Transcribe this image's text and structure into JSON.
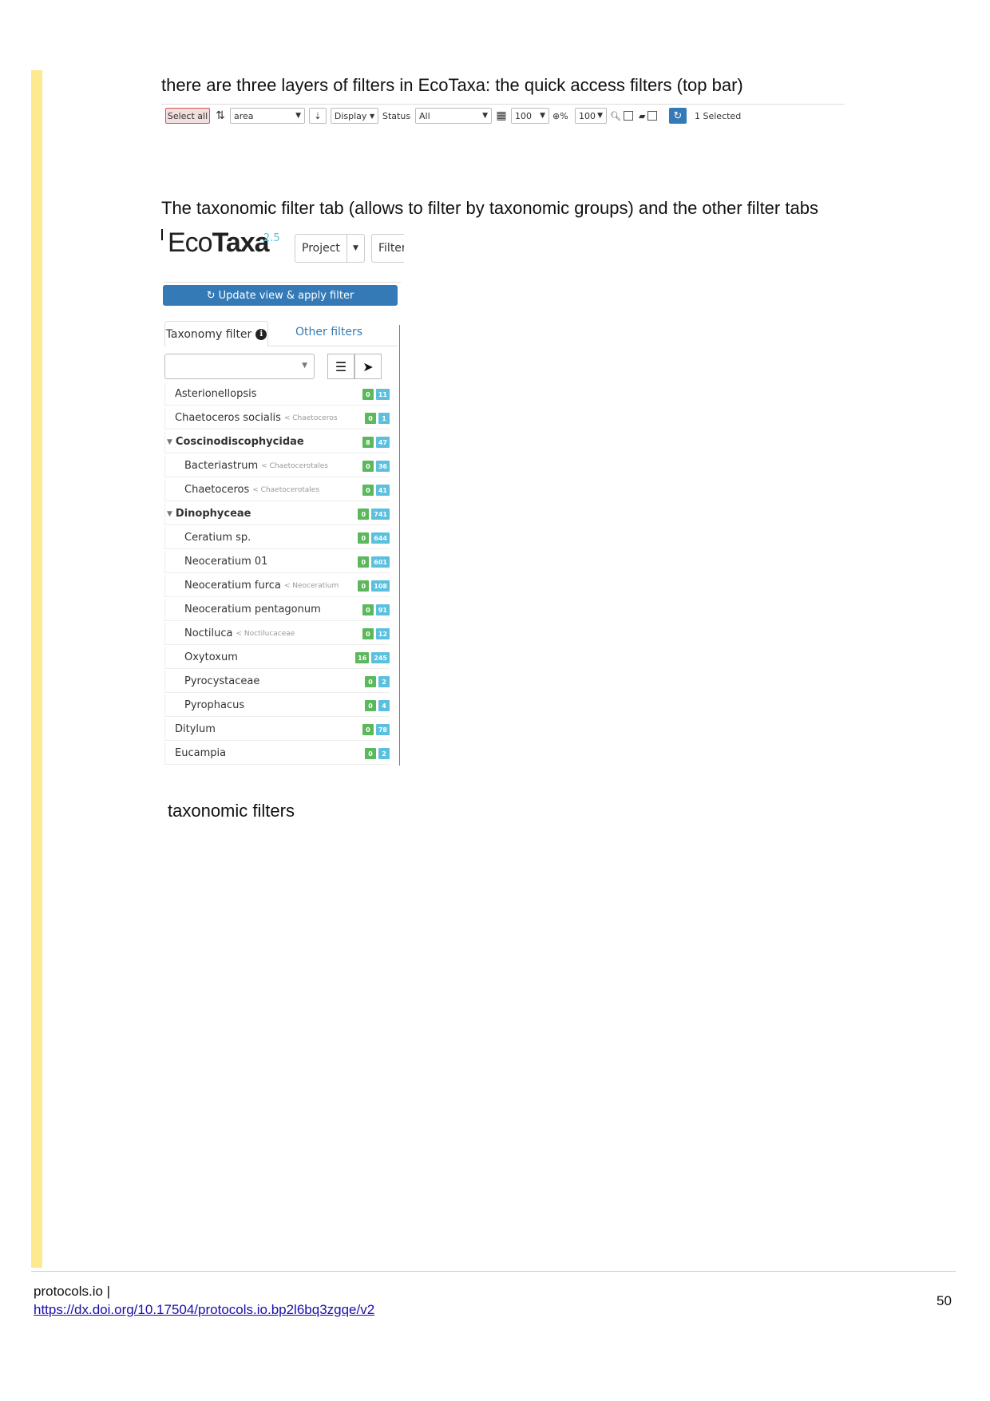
{
  "text": {
    "p1": "there are three layers of filters in EcoTaxa: the quick access filters (top bar)",
    "p2": "The taxonomic filter tab (allows to filter by taxonomic groups) and the other filter tabs",
    "caption": "taxonomic filters"
  },
  "toolbar": {
    "select_all": "Select all",
    "sort_field": "area",
    "display_label": "Display",
    "status_label": "Status",
    "status_value": "All",
    "page_size": "100",
    "zoom_pct": "%",
    "zoom_value": "100",
    "selected_text": "1 Selected"
  },
  "ecotaxa": {
    "logo_eco": "Eco",
    "logo_taxa": "Taxa",
    "version": "2.5",
    "project_btn": "Project",
    "filter_btn": "Filter",
    "update_btn": "Update view & apply filter",
    "tab_taxonomy": "Taxonomy filter",
    "tab_other": "Other filters",
    "taxa": [
      {
        "name": "Asterionellopsis",
        "anc": "",
        "g": "0",
        "b": "11"
      },
      {
        "name": "Chaetoceros socialis",
        "anc": "< Chaetoceros",
        "g": "0",
        "b": "1"
      },
      {
        "name": "Coscinodiscophycidae",
        "anc": "",
        "g": "8",
        "b": "47"
      },
      {
        "name": "Bacteriastrum",
        "anc": "< Chaetocerotales",
        "g": "0",
        "b": "36"
      },
      {
        "name": "Chaetoceros",
        "anc": "< Chaetocerotales",
        "g": "0",
        "b": "41"
      },
      {
        "name": "Dinophyceae",
        "anc": "",
        "g": "0",
        "b": "741"
      },
      {
        "name": "Ceratium sp.",
        "anc": "",
        "g": "0",
        "b": "644"
      },
      {
        "name": "Neoceratium 01",
        "anc": "",
        "g": "0",
        "b": "601"
      },
      {
        "name": "Neoceratium furca",
        "anc": "< Neoceratium",
        "g": "0",
        "b": "108"
      },
      {
        "name": "Neoceratium pentagonum",
        "anc": "",
        "g": "0",
        "b": "91"
      },
      {
        "name": "Noctiluca",
        "anc": "< Noctilucaceae",
        "g": "0",
        "b": "12"
      },
      {
        "name": "Oxytoxum",
        "anc": "",
        "g": "16",
        "b": "245"
      },
      {
        "name": "Pyrocystaceae",
        "anc": "",
        "g": "0",
        "b": "2"
      },
      {
        "name": "Pyrophacus",
        "anc": "",
        "g": "0",
        "b": "4"
      },
      {
        "name": "Ditylum",
        "anc": "",
        "g": "0",
        "b": "78"
      },
      {
        "name": "Eucampia",
        "anc": "",
        "g": "0",
        "b": "2"
      }
    ]
  },
  "footer": {
    "site": "protocols.io |",
    "doi": "https://dx.doi.org/10.17504/protocols.io.bp2l6bq3zgqe/v2",
    "page": "50"
  }
}
